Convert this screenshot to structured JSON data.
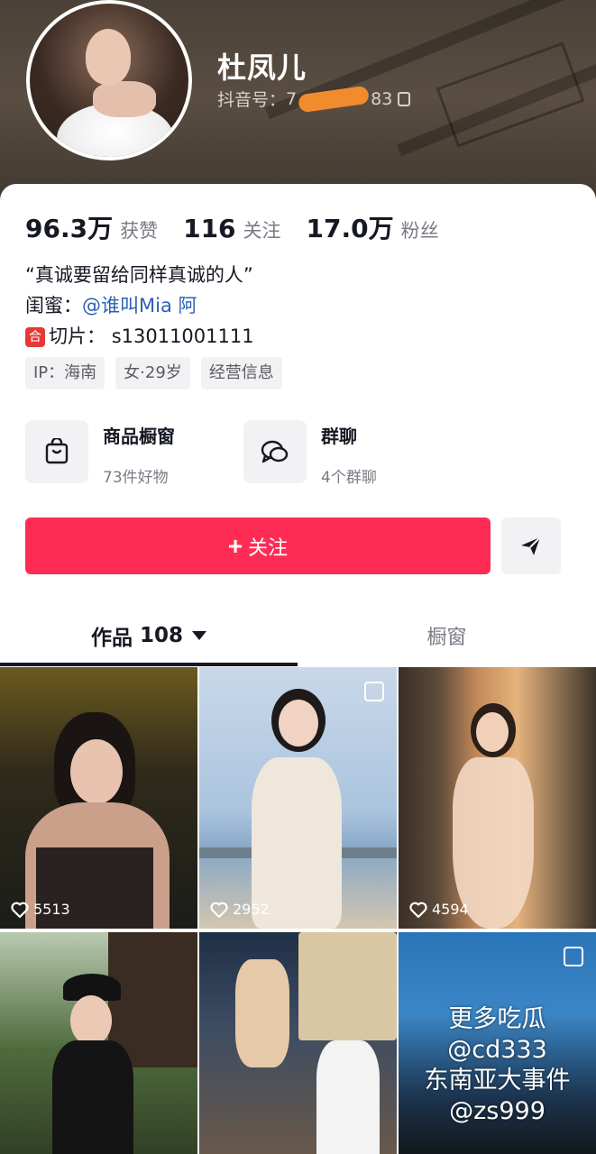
{
  "profile": {
    "name": "杜凤儿",
    "douyin_id_label": "抖音号：",
    "douyin_id_prefix": "7",
    "douyin_id_suffix": "83"
  },
  "stats": [
    {
      "value": "96.3万",
      "label": "获赞"
    },
    {
      "value": "116",
      "label": "关注"
    },
    {
      "value": "17.0万",
      "label": "粉丝"
    }
  ],
  "bio": {
    "line1": "“真诚要留给同样真诚的人”",
    "bestie_label": "闺蜜：",
    "bestie_mention": "@谁叫Mia 阿",
    "clip_badge": "合",
    "clip_label": "切片：",
    "clip_value": "s13011001111"
  },
  "tags": [
    "IP：海南",
    "女·29岁",
    "经营信息"
  ],
  "features": [
    {
      "title": "商品橱窗",
      "sub": "73件好物",
      "icon": "shopping-bag-icon"
    },
    {
      "title": "群聊",
      "sub": "4个群聊",
      "icon": "chat-bubbles-icon"
    }
  ],
  "actions": {
    "follow_plus": "+",
    "follow_label": "关注",
    "share_icon": "send-icon"
  },
  "tabs": {
    "works_label": "作品",
    "works_count": "108",
    "window_label": "橱窗"
  },
  "videos": [
    {
      "likes": "5513"
    },
    {
      "likes": "2952"
    },
    {
      "likes": "4594"
    }
  ],
  "overlay": {
    "line1": "更多吃瓜",
    "line2": "@cd333",
    "line3": "东南亚大事件",
    "line4": "@zs999"
  },
  "colors": {
    "accent": "#fe2c55",
    "mention": "#2b5fb4",
    "redaction": "#f28a2e"
  }
}
